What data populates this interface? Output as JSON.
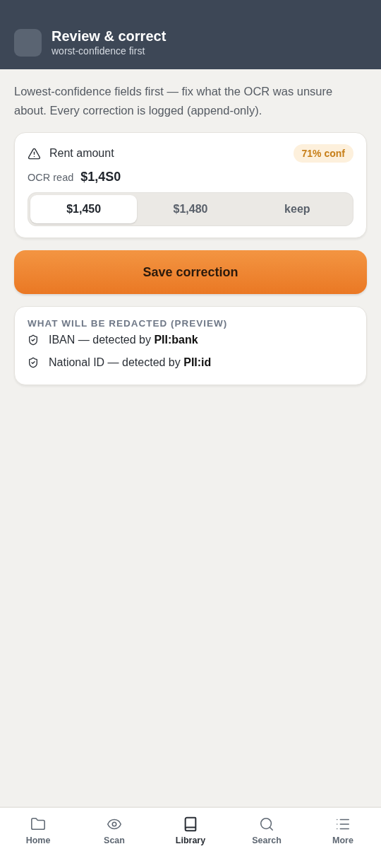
{
  "header": {
    "title": "Review & correct",
    "subtitle": "worst-confidence first"
  },
  "intro": "Lowest-confidence fields first — fix what the OCR was unsure about. Every correction is logged (append-only).",
  "field": {
    "label": "Rent amount",
    "confidence": "71% conf",
    "ocr_label": "OCR read",
    "ocr_value": "$1,4S0",
    "options": [
      {
        "label": "$1,450",
        "selected": true
      },
      {
        "label": "$1,480",
        "selected": false
      },
      {
        "label": "keep",
        "selected": false
      }
    ]
  },
  "save_button": "Save correction",
  "redaction": {
    "title": "WHAT WILL BE REDACTED (PREVIEW)",
    "items": [
      "IBAN — detected by **PII:bank**",
      "National ID — detected by **PII:id**"
    ]
  },
  "nav": [
    {
      "kind": "folder",
      "label": "Home",
      "selected": false
    },
    {
      "kind": "eye",
      "label": "Scan",
      "selected": false
    },
    {
      "kind": "book",
      "label": "Library",
      "selected": true
    },
    {
      "kind": "search",
      "label": "Search",
      "selected": false
    },
    {
      "kind": "list",
      "label": "More",
      "selected": false
    }
  ]
}
